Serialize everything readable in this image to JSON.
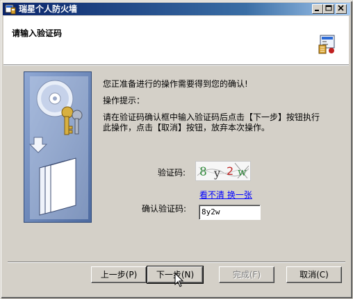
{
  "window": {
    "title": "瑞星个人防火墙"
  },
  "header": {
    "title": "请输入验证码"
  },
  "content": {
    "line1": "您正准备进行的操作需要得到您的确认!",
    "tips_label": "操作提示：",
    "tips_line1": "请在验证码确认框中输入验证码后点击【下一步】按钮执行",
    "tips_line2": "此操作，点击【取消】按钮，放弃本次操作。",
    "captcha_label": "验证码:",
    "captcha_text": "8y2w",
    "refresh_link": "看不清 换一张",
    "confirm_label": "确认验证码:",
    "confirm_value": "8y2w"
  },
  "buttons": {
    "back": "上一步",
    "back_key": "(P)",
    "next": "下一步",
    "next_key": "(N)",
    "finish": "完成",
    "finish_key": "(F)",
    "cancel": "取消",
    "cancel_key": "(C)"
  },
  "colors": {
    "titlebar_start": "#0a246a",
    "dialog_bg": "#d4d0c8",
    "link": "#0000ff"
  }
}
